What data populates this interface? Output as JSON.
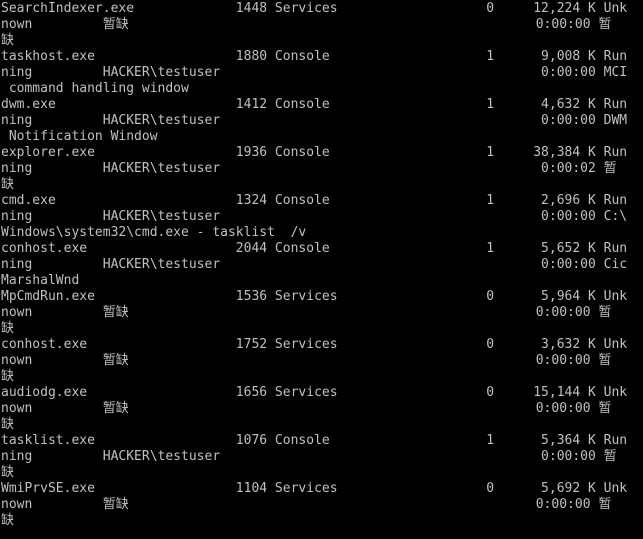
{
  "console": {
    "text_color": "#c0c0c0",
    "background_color": "#000000",
    "lines": [
      "SearchIndexer.exe             1448 Services                   0     12,224 K Unk",
      "nown         暂缺                                                    0:00:00 暂",
      "缺",
      "taskhost.exe                  1880 Console                    1      9,008 K Run",
      "ning         HACKER\\testuser                                         0:00:00 MCI",
      " command handling window",
      "dwm.exe                       1412 Console                    1      4,632 K Run",
      "ning         HACKER\\testuser                                         0:00:00 DWM",
      " Notification Window",
      "explorer.exe                  1936 Console                    1     38,384 K Run",
      "ning         HACKER\\testuser                                         0:00:02 暂",
      "缺",
      "cmd.exe                       1324 Console                    1      2,696 K Run",
      "ning         HACKER\\testuser                                         0:00:00 C:\\",
      "Windows\\system32\\cmd.exe - tasklist  /v",
      "conhost.exe                   2044 Console                    1      5,652 K Run",
      "ning         HACKER\\testuser                                         0:00:00 Cic",
      "MarshalWnd",
      "MpCmdRun.exe                  1536 Services                   0      5,964 K Unk",
      "nown         暂缺                                                    0:00:00 暂",
      "缺",
      "conhost.exe                   1752 Services                   0      3,632 K Unk",
      "nown         暂缺                                                    0:00:00 暂",
      "缺",
      "audiodg.exe                   1656 Services                   0     15,144 K Unk",
      "nown         暂缺                                                    0:00:00 暂",
      "缺",
      "tasklist.exe                  1076 Console                    1      5,364 K Run",
      "ning         HACKER\\testuser                                         0:00:00 暂",
      "缺",
      "WmiPrvSE.exe                  1104 Services                   0      5,692 K Unk",
      "nown         暂缺                                                    0:00:00 暂",
      "缺"
    ]
  }
}
